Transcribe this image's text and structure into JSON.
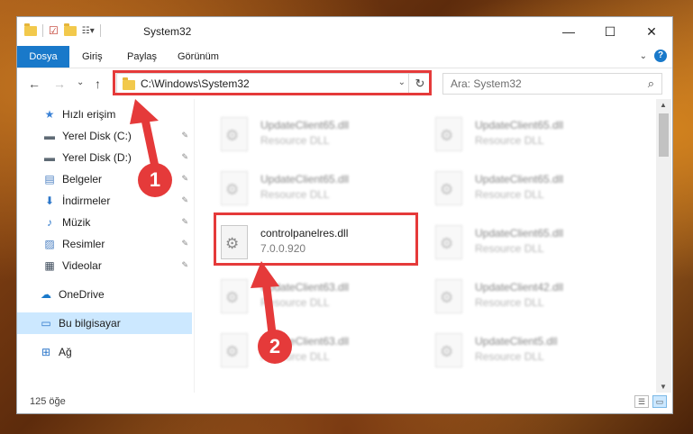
{
  "window": {
    "title": "System32",
    "controls": {
      "minimize": "—",
      "maximize": "☐",
      "close": "✕"
    }
  },
  "ribbon": {
    "tabs": [
      "Dosya",
      "Giriş",
      "Paylaş",
      "Görünüm"
    ],
    "help": "?"
  },
  "navigation": {
    "back": "←",
    "forward": "→",
    "recent": "⌄",
    "up": "↑",
    "address": "C:\\Windows\\System32",
    "refresh": "↻",
    "search_placeholder": "Ara: System32"
  },
  "sidebar": {
    "items": [
      {
        "label": "Hızlı erişim",
        "icon": "star-icon",
        "glyph": "★",
        "color": "#3b82d6"
      },
      {
        "label": "Yerel Disk (C:)",
        "icon": "drive-icon",
        "glyph": "▬",
        "color": "#5f6a75",
        "pinned": true
      },
      {
        "label": "Yerel Disk (D:)",
        "icon": "drive-icon",
        "glyph": "▬",
        "color": "#5f6a75",
        "pinned": true
      },
      {
        "label": "Belgeler",
        "icon": "documents-icon",
        "glyph": "▤",
        "color": "#4a7fc1",
        "pinned": true
      },
      {
        "label": "İndirmeler",
        "icon": "download-icon",
        "glyph": "⬇",
        "color": "#2b76c9",
        "pinned": true
      },
      {
        "label": "Müzik",
        "icon": "music-icon",
        "glyph": "♪",
        "color": "#2b76c9",
        "pinned": true
      },
      {
        "label": "Resimler",
        "icon": "pictures-icon",
        "glyph": "▨",
        "color": "#4a7fc1",
        "pinned": true
      },
      {
        "label": "Videolar",
        "icon": "videos-icon",
        "glyph": "▦",
        "color": "#3c4a5a",
        "pinned": true
      },
      {
        "label": "OneDrive",
        "icon": "cloud-icon",
        "glyph": "☁",
        "color": "#1979ca"
      },
      {
        "label": "Bu bilgisayar",
        "icon": "computer-icon",
        "glyph": "▭",
        "color": "#2b76c9",
        "selected": true
      },
      {
        "label": "Ağ",
        "icon": "network-icon",
        "glyph": "⊞",
        "color": "#2b76c9"
      }
    ],
    "pin_glyph": "📌"
  },
  "files": [
    {
      "name": "UpdateClient65.dll",
      "sub": "Resource DLL",
      "blurred": true
    },
    {
      "name": "UpdateClient65.dll",
      "sub": "Resource DLL",
      "blurred": true
    },
    {
      "name": "UpdateClient65.dll",
      "sub": "Resource DLL",
      "blurred": true
    },
    {
      "name": "UpdateClient65.dll",
      "sub": "Resource DLL",
      "blurred": true
    },
    {
      "name": "controlpanelres.dll",
      "sub": "7.0.0.920",
      "blurred": false
    },
    {
      "name": "UpdateClient65.dll",
      "sub": "Resource DLL",
      "blurred": true
    },
    {
      "name": "UpdateClient63.dll",
      "sub": "Resource DLL",
      "blurred": true
    },
    {
      "name": "UpdateClient42.dll",
      "sub": "Resource DLL",
      "blurred": true
    },
    {
      "name": "UpdateClient63.dll",
      "sub": "Resource DLL",
      "blurred": true
    },
    {
      "name": "UpdateClient5.dll",
      "sub": "Resource DLL",
      "blurred": true
    }
  ],
  "status": {
    "count": "125 öğe"
  },
  "annotations": {
    "step1": "1",
    "step2": "2",
    "highlight_color": "#e53a3a"
  }
}
